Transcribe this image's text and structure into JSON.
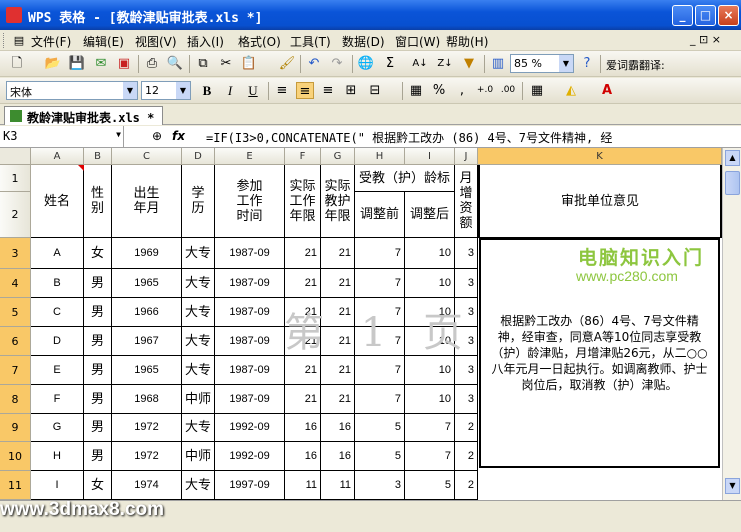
{
  "window": {
    "title": "WPS 表格 - [教龄津贴审批表.xls *]",
    "minimize_label": "_",
    "maximize_label": "□",
    "close_label": "×"
  },
  "menubar": {
    "items": [
      "文件(F)",
      "编辑(E)",
      "视图(V)",
      "插入(I)",
      "格式(O)",
      "工具(T)",
      "数据(D)",
      "窗口(W)",
      "帮助(H)"
    ],
    "right": "_ ⊡ ×"
  },
  "toolbar1": {
    "zoom": "85 %",
    "translate_label": "爱词霸翻译:"
  },
  "toolbar2": {
    "font_name": "宋体",
    "font_size": "12",
    "bold": "B",
    "italic": "I",
    "underline": "U"
  },
  "tab": {
    "label": "教龄津贴审批表.xls *"
  },
  "formulabar": {
    "cell_ref": "K3",
    "fx": "fx",
    "formula": "=IF(I3>0,CONCATENATE(\"     根据黔工改办 (86) 4号、7号文件精神, 经"
  },
  "columns": [
    "A",
    "B",
    "C",
    "D",
    "E",
    "F",
    "G",
    "H",
    "I",
    "J",
    "K"
  ],
  "header": {
    "name": "姓名",
    "gender": "性别",
    "birth": "出生年月",
    "edu": "学历",
    "work_start": "参加工作时间",
    "actual_years": "实际工作年限",
    "teach_years": "实际教护年限",
    "age_group": "受教（护）龄标",
    "adj_before": "调整前",
    "adj_after": "调整后",
    "monthly": "月增资额",
    "opinion": "审批单位意见"
  },
  "rows": [
    {
      "row": "3",
      "name": "A",
      "gender": "女",
      "birth": "1969",
      "edu": "大专",
      "work": "1987-09",
      "f": "21",
      "g": "21",
      "h": "7",
      "i": "10",
      "j": "3"
    },
    {
      "row": "4",
      "name": "B",
      "gender": "男",
      "birth": "1965",
      "edu": "大专",
      "work": "1987-09",
      "f": "21",
      "g": "21",
      "h": "7",
      "i": "10",
      "j": "3"
    },
    {
      "row": "5",
      "name": "C",
      "gender": "男",
      "birth": "1966",
      "edu": "大专",
      "work": "1987-09",
      "f": "21",
      "g": "21",
      "h": "7",
      "i": "10",
      "j": "3"
    },
    {
      "row": "6",
      "name": "D",
      "gender": "男",
      "birth": "1967",
      "edu": "大专",
      "work": "1987-09",
      "f": "21",
      "g": "21",
      "h": "7",
      "i": "10",
      "j": "3"
    },
    {
      "row": "7",
      "name": "E",
      "gender": "男",
      "birth": "1965",
      "edu": "大专",
      "work": "1987-09",
      "f": "21",
      "g": "21",
      "h": "7",
      "i": "10",
      "j": "3"
    },
    {
      "row": "8",
      "name": "F",
      "gender": "男",
      "birth": "1968",
      "edu": "中师",
      "work": "1987-09",
      "f": "21",
      "g": "21",
      "h": "7",
      "i": "10",
      "j": "3"
    },
    {
      "row": "9",
      "name": "G",
      "gender": "男",
      "birth": "1972",
      "edu": "大专",
      "work": "1992-09",
      "f": "16",
      "g": "16",
      "h": "5",
      "i": "7",
      "j": "2"
    },
    {
      "row": "10",
      "name": "H",
      "gender": "男",
      "birth": "1972",
      "edu": "中师",
      "work": "1992-09",
      "f": "16",
      "g": "16",
      "h": "5",
      "i": "7",
      "j": "2"
    },
    {
      "row": "11",
      "name": "I",
      "gender": "女",
      "birth": "1974",
      "edu": "大专",
      "work": "1997-09",
      "f": "11",
      "g": "11",
      "h": "3",
      "i": "5",
      "j": "2"
    }
  ],
  "opinion_text": "根据黔工改办（86）4号、7号文件精神，经审查，同意A等10位同志享受教（护）龄津贴，月增津贴26元，从二○○八年元月一日起执行。如调离教师、护士岗位后，取消教（护）津贴。",
  "watermarks": {
    "logo": "电脑知识入门",
    "url": "www.pc280.com",
    "page": "第 1 页",
    "bottom": "www.3dmax8.com"
  }
}
